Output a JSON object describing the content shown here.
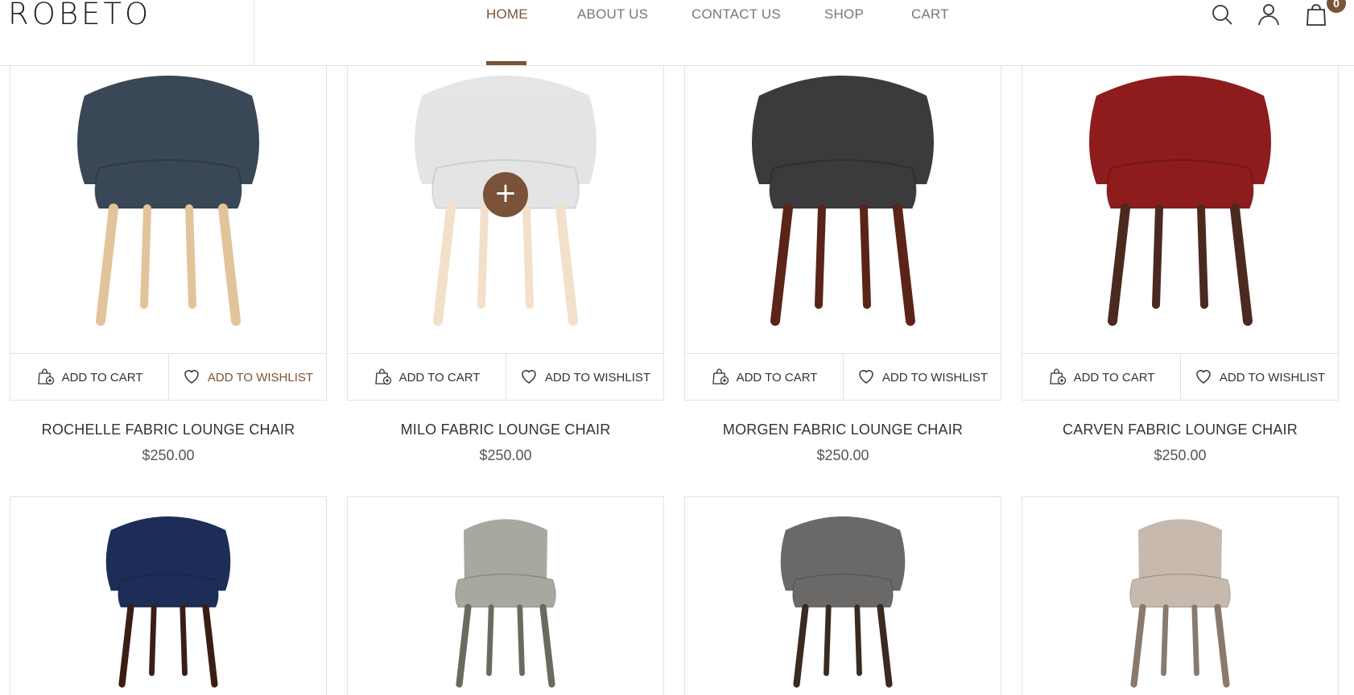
{
  "brand": {
    "logo": "ROBETO",
    "accent": "#7a5237"
  },
  "nav": {
    "items": [
      {
        "label": "HOME",
        "active": true
      },
      {
        "label": "ABOUT US",
        "active": false
      },
      {
        "label": "CONTACT US",
        "active": false
      },
      {
        "label": "SHOP",
        "active": false
      },
      {
        "label": "CART",
        "active": false
      }
    ]
  },
  "header_icons": {
    "search": "search-icon",
    "account": "user-icon",
    "cart": "shopping-bag-icon",
    "cart_count": "0"
  },
  "product_actions": {
    "add_to_cart": "ADD TO CART",
    "add_to_wishlist": "ADD TO WISHLIST",
    "quick_add": "+"
  },
  "products": [
    {
      "name": "ROCHELLE FABRIC LOUNGE CHAIR",
      "price": "$250.00",
      "seat_color": "#3a4756",
      "leg_color": "#e3c39b"
    },
    {
      "name": "MILO FABRIC LOUNGE CHAIR",
      "price": "$250.00",
      "seat_color": "#cfcfcf",
      "leg_color": "#e8c8a0"
    },
    {
      "name": "MORGEN FABRIC LOUNGE CHAIR",
      "price": "$250.00",
      "seat_color": "#3b3a3c",
      "leg_color": "#5a2418"
    },
    {
      "name": "CARVEN FABRIC LOUNGE CHAIR",
      "price": "$250.00",
      "seat_color": "#8e1c1c",
      "leg_color": "#4a2a20"
    },
    {
      "name": "",
      "price": "",
      "seat_color": "#1c2e57",
      "leg_color": "#3a1e16"
    },
    {
      "name": "",
      "price": "",
      "seat_color": "#a8a89e",
      "leg_color": "#6a6a60"
    },
    {
      "name": "",
      "price": "",
      "seat_color": "#6b6967",
      "leg_color": "#3a2a20"
    },
    {
      "name": "",
      "price": "",
      "seat_color": "#c7b9ad",
      "leg_color": "#8a7a6e"
    }
  ]
}
